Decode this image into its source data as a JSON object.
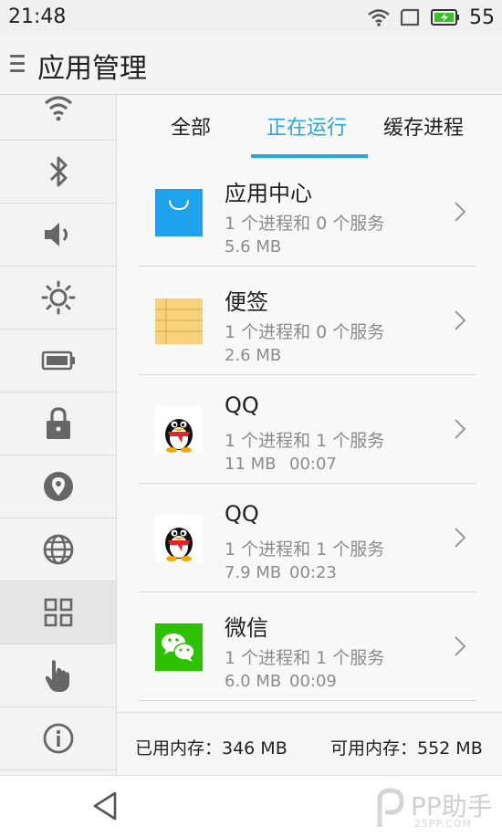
{
  "status_bar": {
    "time": "21:48",
    "battery_level": "55",
    "battery_color": "#3cbf2a"
  },
  "title_bar": {
    "title": "应用管理"
  },
  "sidebar": {
    "items": [
      {
        "icon": "wifi-icon"
      },
      {
        "icon": "bluetooth-icon"
      },
      {
        "icon": "volume-icon"
      },
      {
        "icon": "brightness-icon"
      },
      {
        "icon": "battery-icon"
      },
      {
        "icon": "lock-icon"
      },
      {
        "icon": "location-icon"
      },
      {
        "icon": "globe-icon"
      },
      {
        "icon": "apps-grid-icon",
        "active": true
      },
      {
        "icon": "hand-gesture-icon"
      },
      {
        "icon": "info-icon"
      }
    ]
  },
  "tabs": [
    {
      "label": "全部"
    },
    {
      "label": "正在运行",
      "active": true
    },
    {
      "label": "缓存进程"
    }
  ],
  "accent_color": "#2aa7d8",
  "apps": [
    {
      "name": "应用中心",
      "desc": "1 个进程和 0 个服务",
      "size": "5.6 MB",
      "time": "",
      "icon": "app-center-icon"
    },
    {
      "name": "便签",
      "desc": "1 个进程和 0 个服务",
      "size": "2.6 MB",
      "time": "",
      "icon": "notes-icon"
    },
    {
      "name": "QQ",
      "desc": "1 个进程和 1 个服务",
      "size": "11 MB",
      "time": "00:07",
      "icon": "qq-icon"
    },
    {
      "name": "QQ",
      "desc": "1 个进程和 1 个服务",
      "size": "7.9 MB",
      "time": "00:23",
      "icon": "qq-icon"
    },
    {
      "name": "微信",
      "desc": "1 个进程和 1 个服务",
      "size": "6.0 MB",
      "time": "00:09",
      "icon": "wechat-icon"
    }
  ],
  "memory": {
    "used": "已用内存：346 MB",
    "free": "可用内存：552 MB"
  },
  "watermark": {
    "text": "PP助手",
    "sub": "25PP.COM"
  }
}
